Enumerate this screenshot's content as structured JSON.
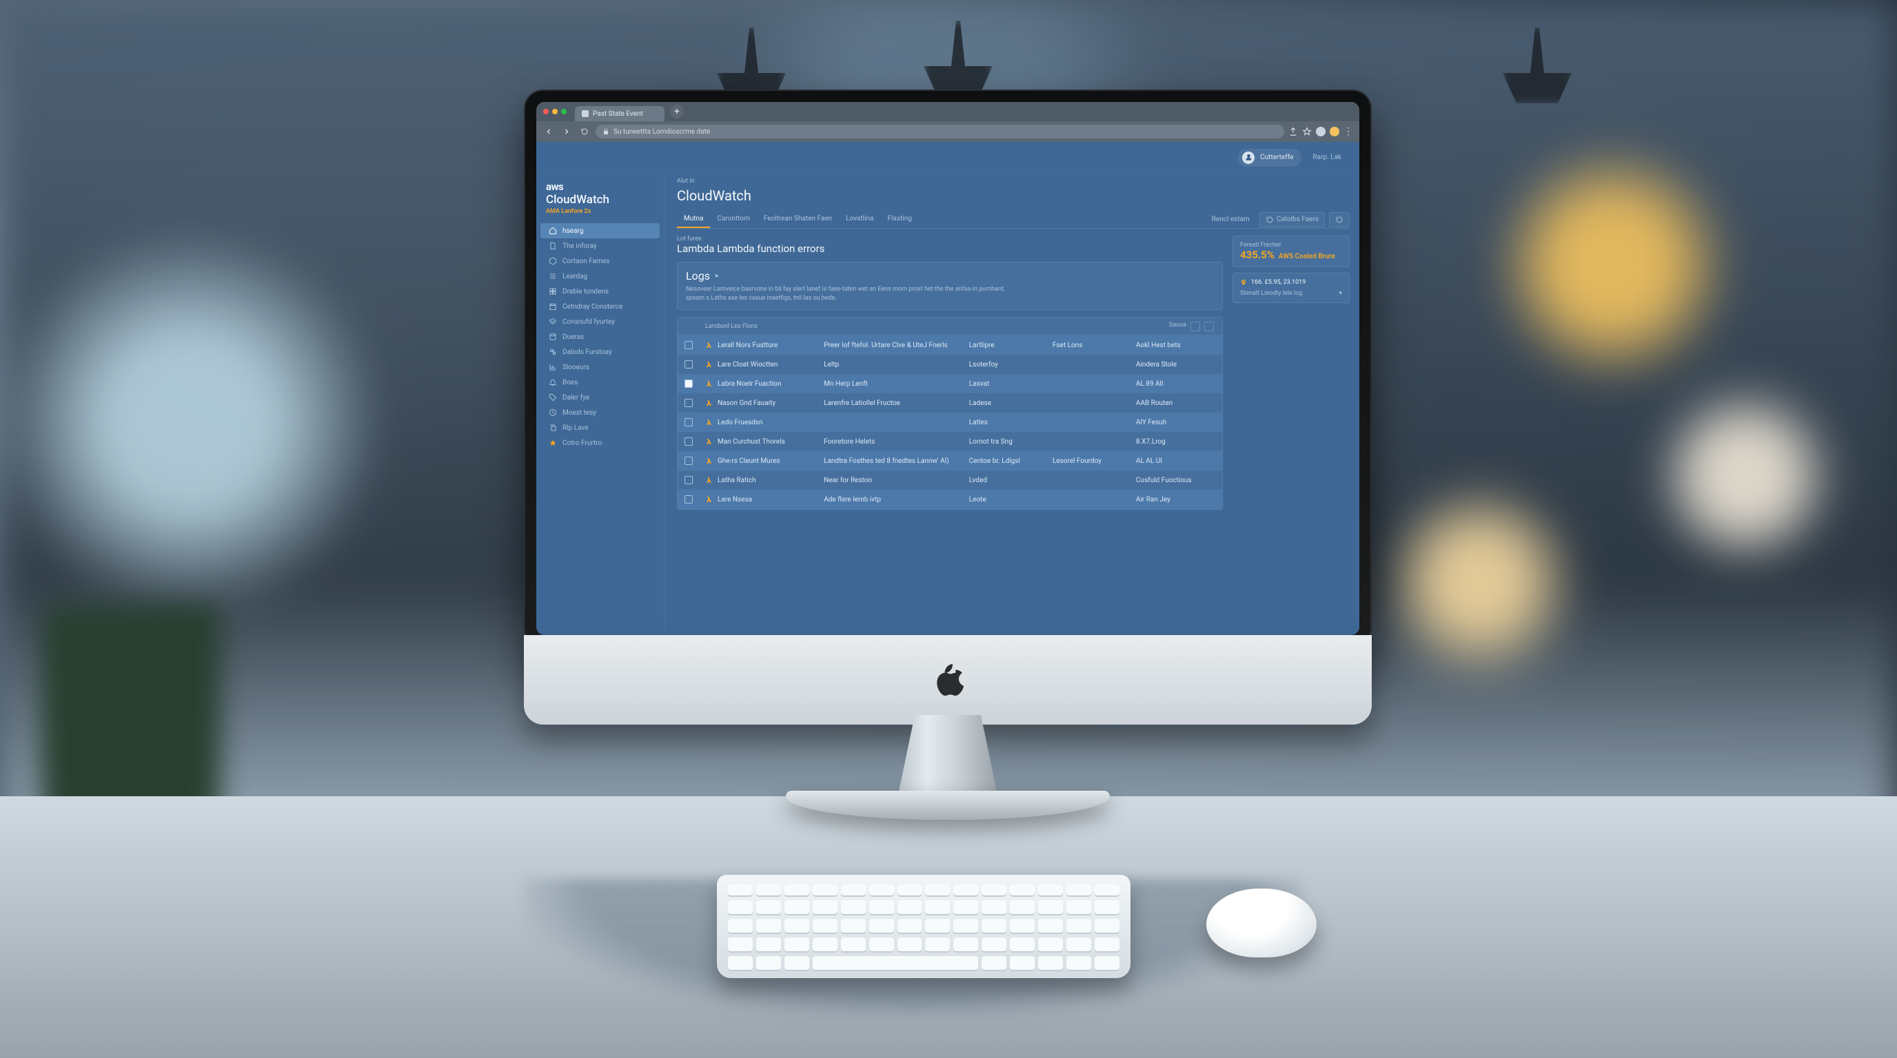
{
  "browser": {
    "tab_title": "Past State Event",
    "url": "Su tuneettta Lomdioscrme date",
    "new_tab_glyph": "+"
  },
  "header": {
    "user_label": "Cutterteffe",
    "region_label": "Rarp. Lak"
  },
  "sidebar": {
    "logo_top": "aws",
    "logo_main": "CloudWatch",
    "logo_sub": "AMA Lanfore 2s",
    "items": [
      {
        "icon": "home",
        "label": "hsearg",
        "active": true
      },
      {
        "icon": "doc",
        "label": "The inforay"
      },
      {
        "icon": "cube",
        "label": "Cortaon Fames"
      },
      {
        "icon": "list",
        "label": "Leardag"
      },
      {
        "icon": "grid",
        "label": "Drable tondens"
      },
      {
        "icon": "calendar",
        "label": "Cetndray Consterce"
      },
      {
        "icon": "layers",
        "label": "Consnufd fyurtey"
      },
      {
        "icon": "db",
        "label": "Dueras"
      },
      {
        "icon": "flow",
        "label": "Dalods Furstoay"
      },
      {
        "icon": "chart",
        "label": "Slooeurs"
      },
      {
        "icon": "bell",
        "label": "Boes"
      },
      {
        "icon": "tag",
        "label": "Daler fye"
      },
      {
        "icon": "clock",
        "label": "Moest tesy"
      },
      {
        "icon": "copy",
        "label": "Rlp Lave"
      },
      {
        "icon": "star",
        "label": "Cotro Frurtro",
        "orange": true
      }
    ]
  },
  "main": {
    "crumb": "Alut  in",
    "title": "CloudWatch",
    "tabs": [
      {
        "label": "Mutna",
        "active": true
      },
      {
        "label": "Caronttom"
      },
      {
        "label": "Feoltrean Shaten Faen"
      },
      {
        "label": "Lovatlina"
      },
      {
        "label": "Flasting"
      }
    ],
    "tab_actions": [
      {
        "label": "Rencl estam"
      },
      {
        "label": "Catolbs Faers",
        "boxed": true
      },
      {
        "label": "",
        "boxed": true,
        "icon_only": true
      }
    ],
    "section_sub": "Lot fures",
    "section_title": "Lambda Lambda function errors",
    "logs": {
      "heading": "Logs",
      "chevron": "▸",
      "line1": "Nesoveer Lamveice basrvone in bil fay slert lanef is faee-taten wet an Eens mom prost het the the anfas-in pumhant.",
      "line2": "spsam s.Laths ase les casue inaetfigs, tnil las ou bede."
    },
    "stats": {
      "label1": "Fereatl Frecher",
      "value1": "435.5%",
      "value1_suffix": "AWS Coaled Brure",
      "pin_label": "166. £5.95, 23.1019",
      "footer_label": "Stenatl Lieodty lele log",
      "footer_chev": "▾"
    },
    "table": {
      "title": "Larobonl Les Flons",
      "right_label": "Saoua",
      "rows": [
        {
          "sel": false,
          "name": "Lerall Nors Fustture",
          "desc": "Preer lof ftefol. Urtare Clve & UteJ Fnerls",
          "c3": "Lartlipre",
          "c4": "Fset Lons",
          "c5": "Aokl Hest bets"
        },
        {
          "sel": false,
          "name": "Lare Cloat Wioctten",
          "desc": "Leltp",
          "c3": "Lsoterfoy",
          "c4": "",
          "c5": "Aindera Stole"
        },
        {
          "sel": true,
          "name": "Labra Noelr Fuaction",
          "desc": "Mn Herp Lenft",
          "c3": "Lasvat",
          "c4": "",
          "c5": "AL 89 All"
        },
        {
          "sel": false,
          "name": "Nason Gnd Fauaity",
          "desc": "Larenfre Latiollel Fructoe",
          "c3": "Ladese",
          "c4": "",
          "c5": "AAB Routen"
        },
        {
          "sel": false,
          "name": "Ledo Fruesdsn",
          "desc": "",
          "c3": "Latles",
          "c4": "",
          "c5": "AlY Fesuh"
        },
        {
          "sel": false,
          "name": "Man Curchust Thorels",
          "desc": "Fooretore Helets",
          "c3": "Lornot tra Sng",
          "c4": "",
          "c5": "8.X7.Lrog"
        },
        {
          "sel": false,
          "name": "Ghe-rs Cleunt Mures",
          "desc": "Landtra Fosthes ted 8 fnedtes Lannw' Al)",
          "c3": "Centoe br. Ldigsl",
          "c4": "Lesorel Fourdoy",
          "c5": "AL AL UI"
        },
        {
          "sel": false,
          "name": "Latha Ratich",
          "desc": "Near for Reston",
          "c3": "Lvded",
          "c4": "",
          "c5": "Cusfuld Fuoctious"
        },
        {
          "sel": false,
          "name": "Lare Nsesa",
          "desc": "Ade flere lemb ivtp",
          "c3": "Leote",
          "c4": "",
          "c5": "Air Ran Jey"
        }
      ]
    }
  }
}
